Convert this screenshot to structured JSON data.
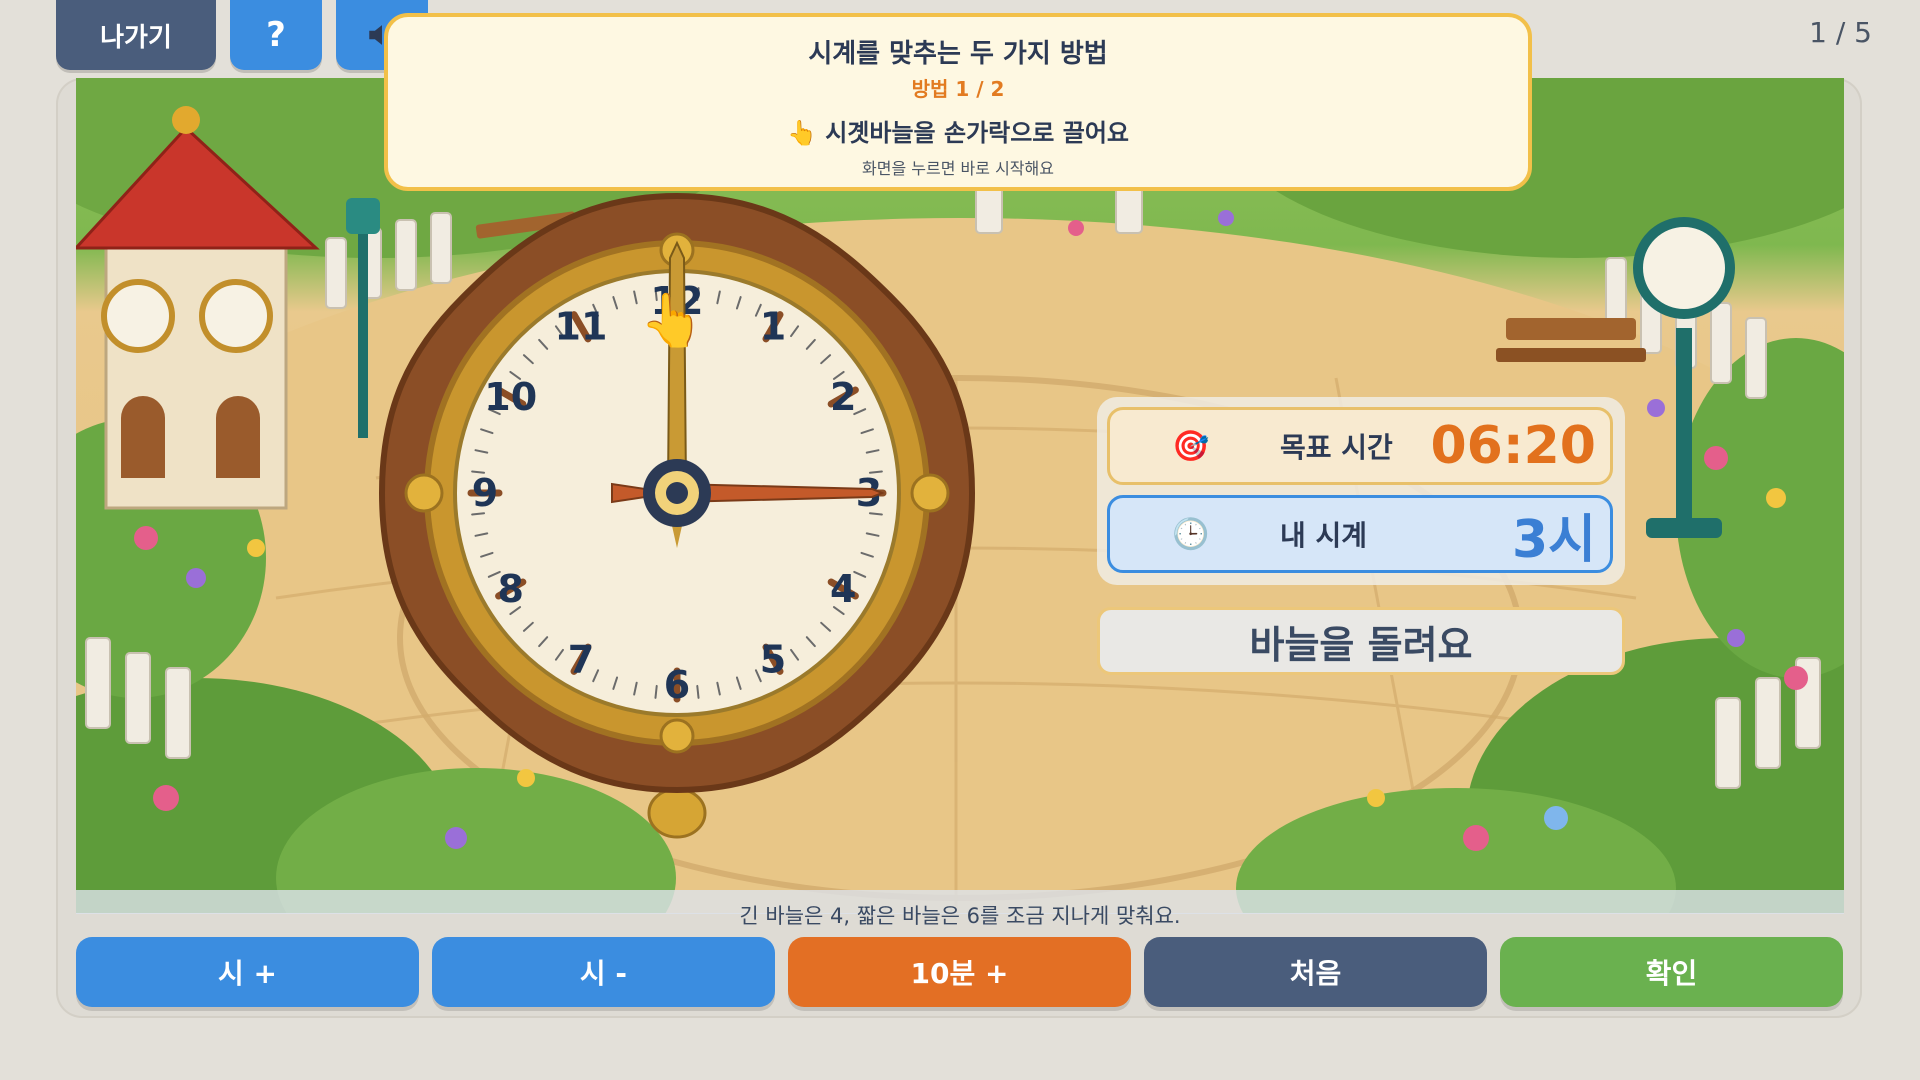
{
  "top": {
    "exit_label": "나가기",
    "help_label": "?",
    "progress": "1 / 5"
  },
  "toast": {
    "title": "시계를 맞추는 두 가지 방법",
    "step": "방법 1 / 2",
    "icon": "👆",
    "line": "시곗바늘을 손가락으로 끌어요",
    "sub": "화면을 누르면 바로 시작해요"
  },
  "clock": {
    "numbers": [
      "12",
      "1",
      "2",
      "3",
      "4",
      "5",
      "6",
      "7",
      "8",
      "9",
      "10",
      "11"
    ],
    "hour_hand_points_to": 3,
    "minute_hand_points_to": 0
  },
  "panel": {
    "target_icon": "🎯",
    "target_label": "목표 시간",
    "target_value": "06:20",
    "mine_icon": "🕒",
    "mine_label": "내 시계",
    "mine_value": "3시"
  },
  "action_text": "바늘을 돌려요",
  "hint": "긴 바늘은 4, 짧은 바늘은 6를 조금 지나게 맞춰요.",
  "buttons": {
    "hour_plus": "시 +",
    "hour_minus": "시 -",
    "ten_min_plus": "10분 +",
    "reset": "처음",
    "confirm": "확인"
  },
  "colors": {
    "blue": "#3b8de0",
    "slate": "#4a5d7c",
    "orange": "#e36f24",
    "green": "#6ab14f",
    "target_orange": "#e2711d",
    "mine_blue": "#3b7fd4"
  }
}
